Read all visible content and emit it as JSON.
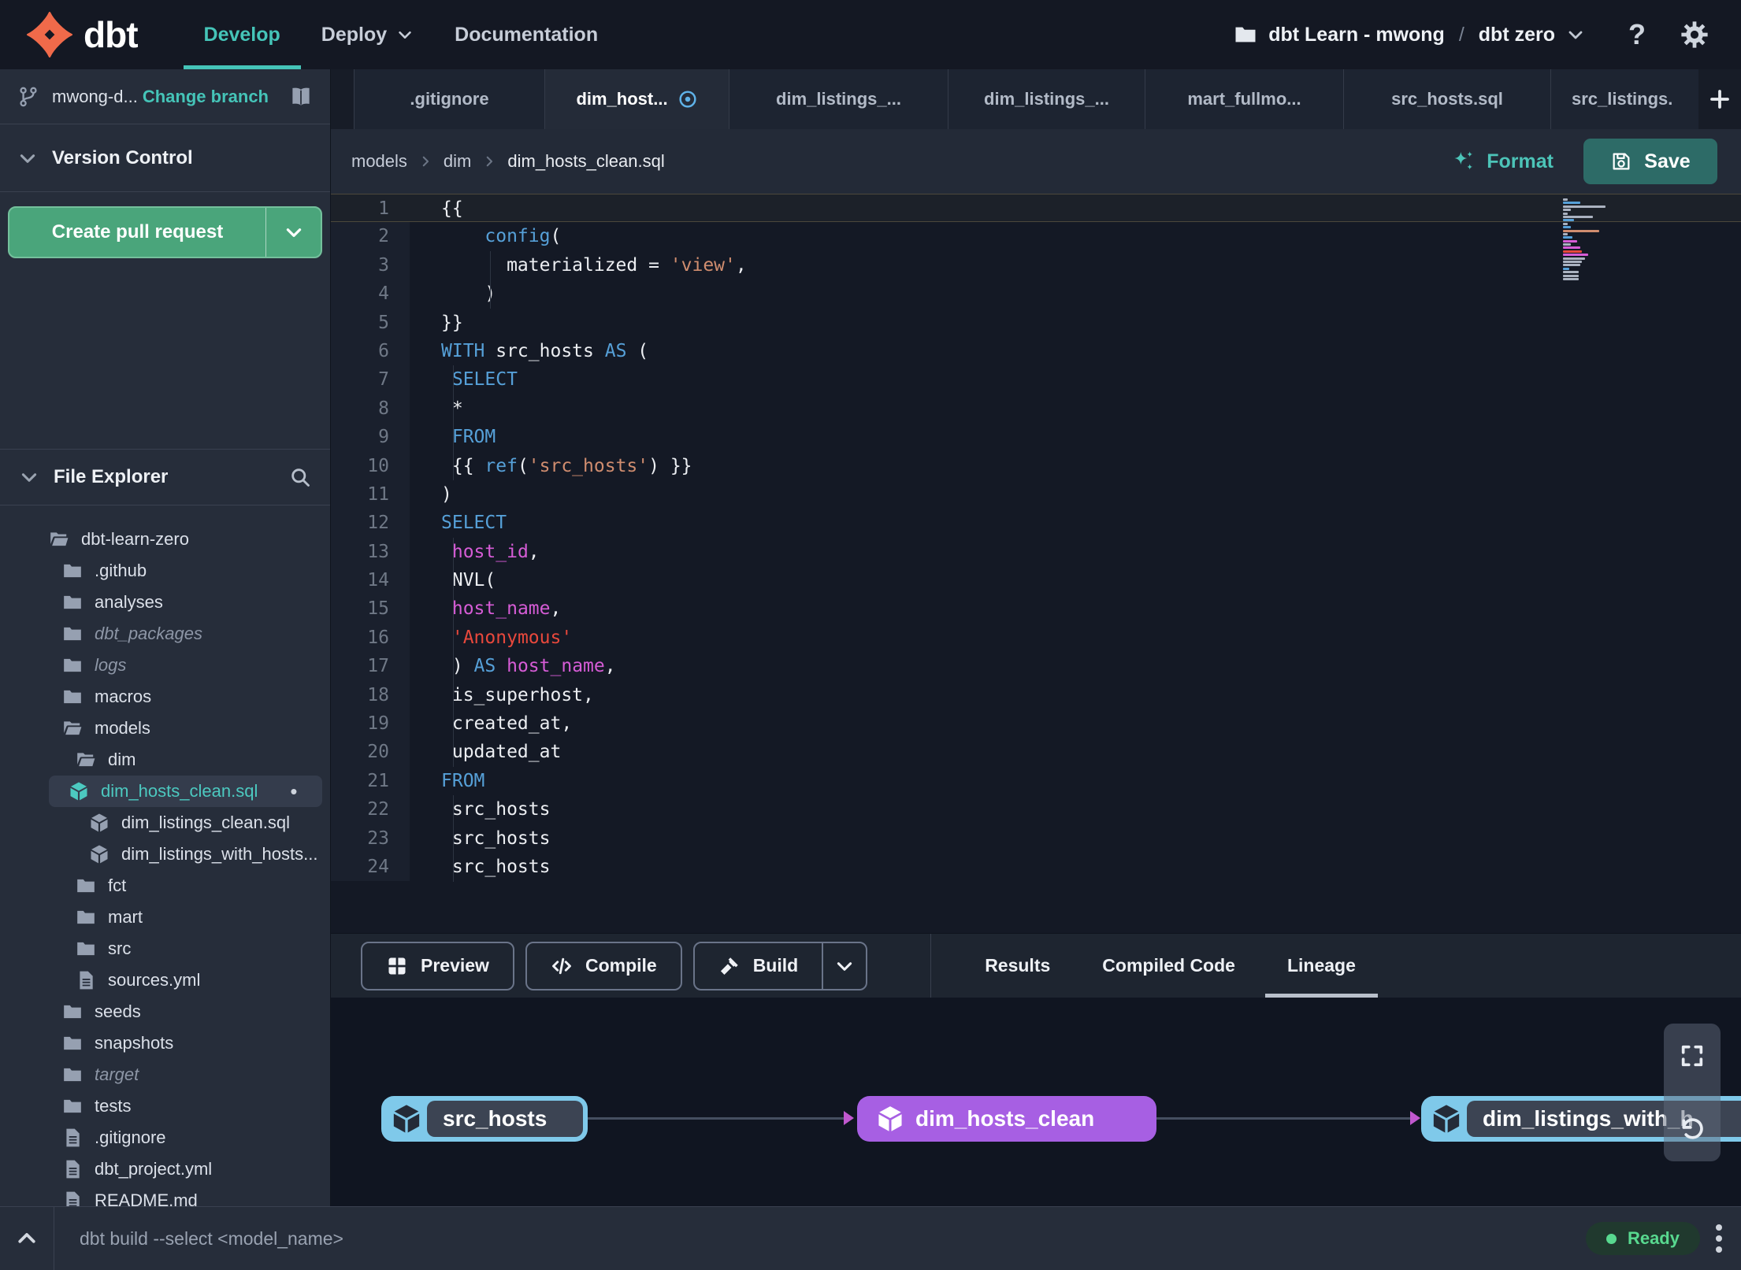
{
  "topnav": {
    "logo_text": "dbt",
    "items": [
      {
        "label": "Develop",
        "active": true,
        "has_dropdown": false
      },
      {
        "label": "Deploy",
        "active": false,
        "has_dropdown": true
      },
      {
        "label": "Documentation",
        "active": false,
        "has_dropdown": false
      }
    ],
    "project": {
      "icon": "folder",
      "account": "dbt Learn - mwong",
      "separator": "/",
      "name": "dbt zero",
      "dropdown_icon": "chevron-down"
    },
    "icons": [
      "help",
      "settings"
    ]
  },
  "sidebar": {
    "branch": {
      "icon": "git-branch",
      "name": "mwong-d...",
      "change_label": "Change branch",
      "docs_icon": "book"
    },
    "version_control_title": "Version Control",
    "create_pr_label": "Create pull request",
    "file_explorer_title": "File Explorer",
    "search_icon": "search",
    "tree": [
      {
        "label": "dbt-learn-zero",
        "icon": "folder-open",
        "depth": 0
      },
      {
        "label": ".github",
        "icon": "folder",
        "depth": 1
      },
      {
        "label": "analyses",
        "icon": "folder",
        "depth": 1
      },
      {
        "label": "dbt_packages",
        "icon": "folder",
        "depth": 1,
        "muted": true
      },
      {
        "label": "logs",
        "icon": "folder",
        "depth": 1,
        "muted": true
      },
      {
        "label": "macros",
        "icon": "folder",
        "depth": 1
      },
      {
        "label": "models",
        "icon": "folder-open",
        "depth": 1
      },
      {
        "label": "dim",
        "icon": "folder-open",
        "depth": 2
      },
      {
        "label": "dim_hosts_clean.sql",
        "icon": "model",
        "depth": 3,
        "selected": true,
        "modified": true
      },
      {
        "label": "dim_listings_clean.sql",
        "icon": "model",
        "depth": 3
      },
      {
        "label": "dim_listings_with_hosts...",
        "icon": "model",
        "depth": 3
      },
      {
        "label": "fct",
        "icon": "folder",
        "depth": 2
      },
      {
        "label": "mart",
        "icon": "folder",
        "depth": 2
      },
      {
        "label": "src",
        "icon": "folder",
        "depth": 2
      },
      {
        "label": "sources.yml",
        "icon": "file",
        "depth": 2
      },
      {
        "label": "seeds",
        "icon": "folder",
        "depth": 1
      },
      {
        "label": "snapshots",
        "icon": "folder",
        "depth": 1
      },
      {
        "label": "target",
        "icon": "folder",
        "depth": 1,
        "muted": true
      },
      {
        "label": "tests",
        "icon": "folder",
        "depth": 1
      },
      {
        "label": ".gitignore",
        "icon": "file",
        "depth": 1
      },
      {
        "label": "dbt_project.yml",
        "icon": "file",
        "depth": 1
      },
      {
        "label": "README.md",
        "icon": "file",
        "depth": 1
      }
    ]
  },
  "tabs": [
    {
      "label": ".gitignore"
    },
    {
      "label": "dim_host...",
      "active": true,
      "modified": true
    },
    {
      "label": "dim_listings_..."
    },
    {
      "label": "dim_listings_..."
    },
    {
      "label": "mart_fullmo..."
    },
    {
      "label": "src_hosts.sql"
    },
    {
      "label": "src_listings."
    }
  ],
  "new_tab_icon": "plus",
  "editor": {
    "breadcrumb": [
      "models",
      "dim",
      "dim_hosts_clean.sql"
    ],
    "format_label": "Format",
    "format_icon": "sparkles",
    "save_label": "Save",
    "save_icon": "floppy",
    "code": [
      [
        [
          "w",
          "{{"
        ]
      ],
      [
        [
          "w",
          "    "
        ],
        [
          "kw",
          "config"
        ],
        [
          "w",
          "("
        ]
      ],
      [
        [
          "w",
          "      materialized = "
        ],
        [
          "str",
          "'view'"
        ],
        [
          "w",
          ","
        ]
      ],
      [
        [
          "w",
          "    )"
        ]
      ],
      [
        [
          "w",
          "}}"
        ]
      ],
      [
        [
          "kw",
          "WITH"
        ],
        [
          "w",
          " src_hosts "
        ],
        [
          "kw",
          "AS"
        ],
        [
          "w",
          " ("
        ]
      ],
      [
        [
          "w",
          " "
        ],
        [
          "kw",
          "SELECT"
        ]
      ],
      [
        [
          "w",
          " *"
        ]
      ],
      [
        [
          "w",
          " "
        ],
        [
          "kw",
          "FROM"
        ]
      ],
      [
        [
          "w",
          " {{ "
        ],
        [
          "kw",
          "ref"
        ],
        [
          "w",
          "("
        ],
        [
          "str",
          "'src_hosts'"
        ],
        [
          "w",
          ") }}"
        ]
      ],
      [
        [
          "w",
          ")"
        ]
      ],
      [
        [
          "kw",
          "SELECT"
        ]
      ],
      [
        [
          "w",
          " "
        ],
        [
          "mag",
          "host_id"
        ],
        [
          "w",
          ","
        ]
      ],
      [
        [
          "w",
          " NVL("
        ]
      ],
      [
        [
          "w",
          " "
        ],
        [
          "mag",
          "host_name"
        ],
        [
          "w",
          ","
        ]
      ],
      [
        [
          "w",
          " "
        ],
        [
          "red",
          "'Anonymous'"
        ]
      ],
      [
        [
          "w",
          " ) "
        ],
        [
          "kw",
          "AS"
        ],
        [
          "w",
          " "
        ],
        [
          "mag",
          "host_name"
        ],
        [
          "w",
          ","
        ]
      ],
      [
        [
          "w",
          " is_superhost,"
        ]
      ],
      [
        [
          "w",
          " created_at,"
        ]
      ],
      [
        [
          "w",
          " updated_at"
        ]
      ],
      [
        [
          "kw",
          "FROM"
        ]
      ],
      [
        [
          "w",
          " src_hosts"
        ]
      ],
      [
        [
          "w",
          " src_hosts"
        ]
      ],
      [
        [
          "w",
          " src_hosts"
        ]
      ]
    ]
  },
  "bottom": {
    "buttons": [
      {
        "label": "Preview",
        "icon": "grid"
      },
      {
        "label": "Compile",
        "icon": "code"
      },
      {
        "label": "Build",
        "icon": "hammer",
        "split": true
      }
    ],
    "tabs": [
      {
        "label": "Results"
      },
      {
        "label": "Compiled Code"
      },
      {
        "label": "Lineage",
        "active": true
      }
    ]
  },
  "lineage": {
    "nodes": [
      {
        "label": "src_hosts",
        "style": "source"
      },
      {
        "label": "dim_hosts_clean",
        "style": "model"
      },
      {
        "label": "dim_listings_with_h",
        "style": "source"
      }
    ],
    "controls": [
      "expand",
      "undo"
    ]
  },
  "statusbar": {
    "toggle_icon": "chevron-up",
    "command": "dbt build --select <model_name>",
    "status": "Ready",
    "menu_icon": "kebab"
  },
  "colors": {
    "accent_teal": "#45c4b8",
    "green_button": "#4aa57b",
    "save_teal": "#2d6b67",
    "keyword_blue": "#56a0d8",
    "string_salmon": "#d08d6f",
    "identifier_magenta": "#d65cd6",
    "string_red": "#e8483c",
    "node_blue": "#7fc9ea",
    "node_purple": "#a75fe3",
    "ready_green": "#58d88f",
    "logo_orange": "#f06a4a"
  }
}
